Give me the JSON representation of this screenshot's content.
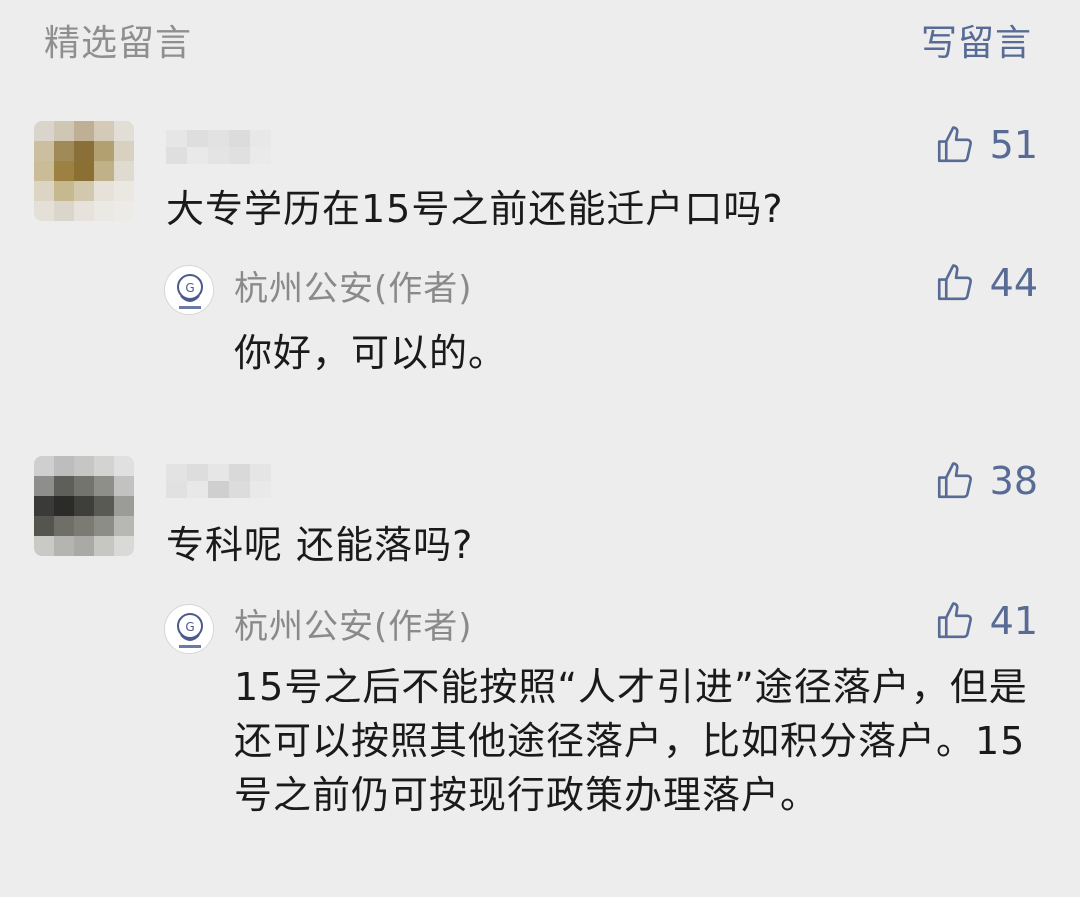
{
  "header": {
    "title": "精选留言",
    "write_label": "写留言"
  },
  "comments": [
    {
      "text": "大专学历在15号之前还能迁户口吗?",
      "likes": "51",
      "reply": {
        "author": "杭州公安(作者)",
        "text": "你好，可以的。",
        "likes": "44"
      }
    },
    {
      "text": "专科呢 还能落吗?",
      "likes": "38",
      "reply": {
        "author": "杭州公安(作者)",
        "text": "15号之后不能按照“人才引进”途径落户，但是还可以按照其他途径落户，比如积分落户。15号之前仍可按现行政策办理落户。",
        "likes": "41"
      }
    }
  ],
  "colors": {
    "link": "#576b95",
    "muted": "#8f8f8f",
    "text": "#1a1a1a",
    "background": "#ededed"
  },
  "icons": {
    "like": "thumbs-up-icon",
    "author_avatar": "police-badge-icon"
  }
}
